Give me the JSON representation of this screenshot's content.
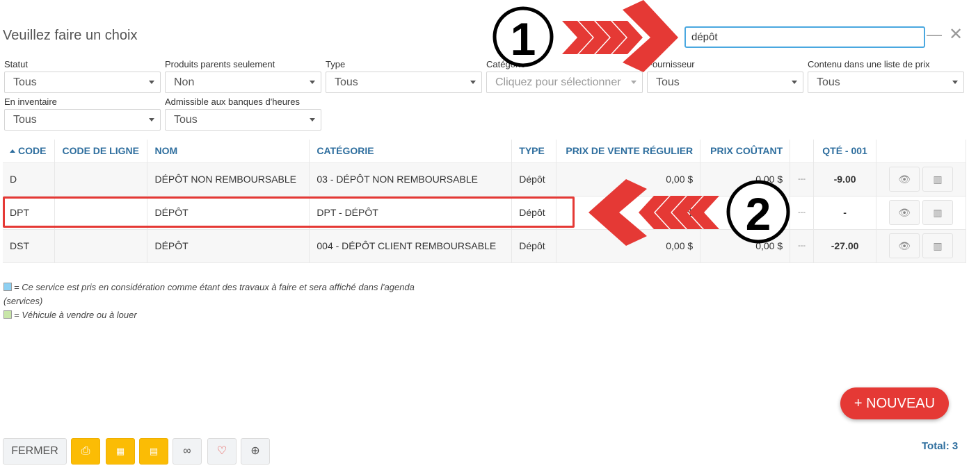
{
  "dialog": {
    "title": "Veuillez faire un choix",
    "search_value": "dépôt"
  },
  "filters": [
    {
      "label": "Statut",
      "value": "Tous"
    },
    {
      "label": "Produits parents seulement",
      "value": "Non"
    },
    {
      "label": "Type",
      "value": "Tous"
    },
    {
      "label": "Catégorie",
      "placeholder": "Cliquez pour sélectionner"
    },
    {
      "label": "Fournisseur",
      "value": "Tous"
    },
    {
      "label": "Contenu dans une liste de prix",
      "value": "Tous"
    },
    {
      "label": "En inventaire",
      "value": "Tous"
    },
    {
      "label": "Admissible aux banques d'heures",
      "value": "Tous"
    }
  ],
  "table": {
    "columns": [
      "CODE",
      "CODE DE LIGNE",
      "NOM",
      "CATÉGORIE",
      "TYPE",
      "PRIX DE VENTE RÉGULIER",
      "PRIX COÛTANT",
      "",
      "QTÉ - 001",
      ""
    ],
    "rows": [
      {
        "code": "D",
        "line_code": "",
        "name": "DÉPÔT NON REMBOURSABLE",
        "category": "03 - DÉPÔT NON REMBOURSABLE",
        "type": "Dépôt",
        "price": "0,00 $",
        "cost": "0,00 $",
        "flag": "---",
        "qty": "-9.00"
      },
      {
        "code": "DPT",
        "line_code": "",
        "name": "DÉPÔT",
        "category": "DPT - DÉPÔT",
        "type": "Dépôt",
        "price": "0,00 $",
        "cost": "0,00 $",
        "flag": "---",
        "qty": "-"
      },
      {
        "code": "DST",
        "line_code": "",
        "name": "DÉPÔT",
        "category": "004 - DÉPÔT CLIENT REMBOURSABLE",
        "type": "Dépôt",
        "price": "0,00 $",
        "cost": "0,00 $",
        "flag": "---",
        "qty": "-27.00"
      }
    ]
  },
  "legend": {
    "services": "= Ce service est pris en considération comme étant des travaux à faire et sera affiché dans l'agenda",
    "services_suffix": "(services)",
    "vehicle": "= Véhicule à vendre ou à louer",
    "colors": {
      "services": "#8ed0f2",
      "vehicle": "#c8e6a8"
    }
  },
  "actions": {
    "new_label": "+ NOUVEAU",
    "close_label": "FERMER",
    "total": "Total: 3"
  },
  "annotations": {
    "step1": "1",
    "step2": "2",
    "color": "#e53935"
  },
  "icons": [
    "print-icon",
    "excel-icon",
    "pdf-icon",
    "link-icon",
    "heart-icon",
    "zoom-icon",
    "eye-icon",
    "barcode-icon"
  ]
}
